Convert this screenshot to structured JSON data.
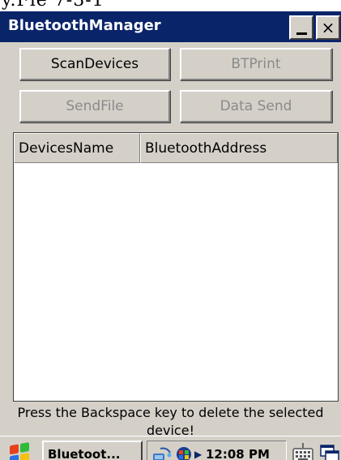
{
  "caption_fragment": "y.Fie 7-3-1",
  "window": {
    "title": "BluetoothManager",
    "minimize_label": "_",
    "close_label": "×"
  },
  "buttons": {
    "scan_devices": "ScanDevices",
    "bt_print": "BTPrint",
    "send_file": "SendFile",
    "data_send": "Data Send"
  },
  "device_list": {
    "columns": [
      "DevicesName",
      "BluetoothAddress"
    ],
    "rows": []
  },
  "hint": "Press the Backspace key to delete the selected device!",
  "taskbar": {
    "start_icon": "windows-flag-icon",
    "active_app": "Bluetoot...",
    "tray_icons": [
      "network-icon",
      "connectivity-icon",
      "expand-arrow-icon"
    ],
    "clock": "12:08 PM",
    "keyboard_icon": "keyboard-icon",
    "desktop_icon": "desktop-icon"
  },
  "colors": {
    "titlebar": "#0a246a",
    "face": "#d4d0c8",
    "disabled_text": "#8a8a8a"
  }
}
